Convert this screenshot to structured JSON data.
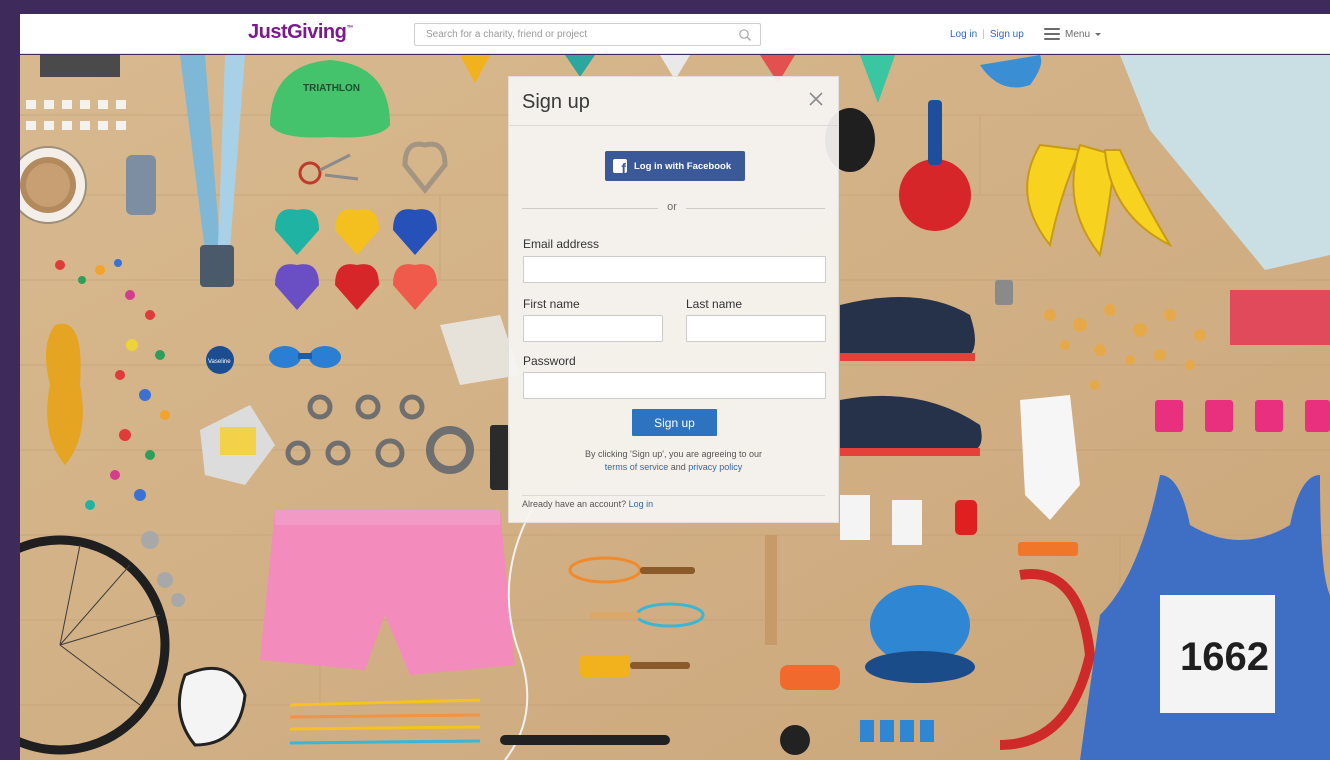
{
  "header": {
    "logo": "JustGiving",
    "logo_tm": "™",
    "search_placeholder": "Search for a charity, friend or project",
    "login_label": "Log in",
    "signup_label": "Sign up",
    "menu_label": "Menu"
  },
  "background": {
    "triathlon_text": "TRIATHLON",
    "race_number": "1662",
    "vaseline_text": "Vaseline"
  },
  "modal": {
    "title": "Sign up",
    "facebook_button": "Log in with Facebook",
    "facebook_icon_letter": "f",
    "or": "or",
    "email_label": "Email address",
    "first_name_label": "First name",
    "last_name_label": "Last name",
    "password_label": "Password",
    "signup_button": "Sign up",
    "terms_prefix": "By clicking 'Sign up', you are agreeing to our",
    "terms_link": "terms of service",
    "terms_and": "and",
    "privacy_link": "privacy policy",
    "already_text": "Already have an account?",
    "already_login": "Log in"
  },
  "colors": {
    "brand": "#7a1a8c",
    "facebook": "#3b5998",
    "primary_button": "#2e73c0",
    "link": "#2b6bb3"
  }
}
